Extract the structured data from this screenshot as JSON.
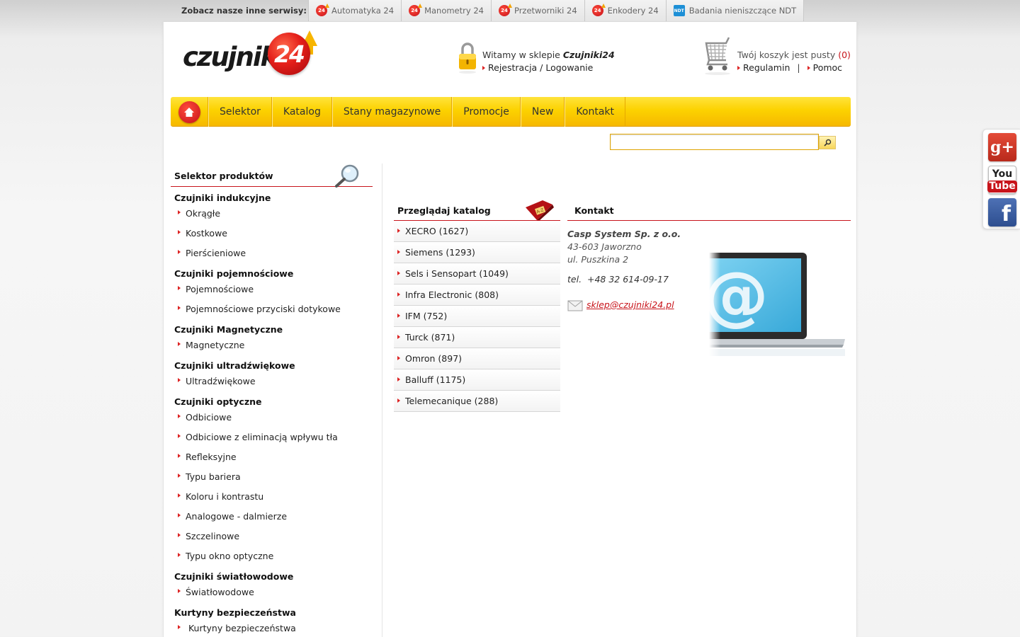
{
  "topbar": {
    "label": "Zobacz nasze inne serwisy:",
    "services": [
      {
        "label": "Automatyka 24",
        "icon": "24-logo-icon",
        "badge": "24"
      },
      {
        "label": "Manometry 24",
        "icon": "24-logo-icon",
        "badge": "24"
      },
      {
        "label": "Przetworniki 24",
        "icon": "24-logo-icon",
        "badge": "24"
      },
      {
        "label": "Enkodery 24",
        "icon": "24-logo-icon",
        "badge": "24"
      },
      {
        "label": "Badania nieniszczące NDT",
        "icon": "ndt-logo-icon",
        "badge": "NDT"
      }
    ]
  },
  "logo": {
    "word": "czujniki",
    "number": "24"
  },
  "welcome": {
    "text": "Witamy w sklepie ",
    "shop": "Czujniki24",
    "auth_link": "Rejestracja / Logowanie"
  },
  "cart": {
    "status": "Twój koszyk jest pusty",
    "count": "(0)",
    "terms": "Regulamin",
    "separator": "|",
    "help": "Pomoc"
  },
  "nav": {
    "home_icon": "home-icon",
    "items": [
      "Selektor",
      "Katalog",
      "Stany magazynowe",
      "Promocje",
      "New",
      "Kontakt"
    ]
  },
  "search": {
    "placeholder": "",
    "value": ""
  },
  "sidebar": {
    "title": "Selektor produktów",
    "groups": [
      {
        "title": "Czujniki indukcyjne",
        "items": [
          "Okrągłe",
          "Kostkowe",
          "Pierścieniowe"
        ]
      },
      {
        "title": "Czujniki pojemnościowe",
        "items": [
          "Pojemnościowe",
          "Pojemnościowe przyciski dotykowe"
        ]
      },
      {
        "title": "Czujniki Magnetyczne",
        "items": [
          "Magnetyczne"
        ]
      },
      {
        "title": "Czujniki ultradźwiękowe",
        "items": [
          "Ultradźwiękowe"
        ]
      },
      {
        "title": "Czujniki optyczne",
        "items": [
          "Odbiciowe",
          "Odbiciowe z eliminacją wpływu tła",
          "Refleksyjne",
          "Typu bariera",
          "Koloru i kontrastu",
          "Analogowe - dalmierze",
          "Szczelinowe",
          "Typu okno optyczne"
        ]
      },
      {
        "title": "Czujniki światłowodowe",
        "items": [
          "Światłowodowe"
        ]
      },
      {
        "title": "Kurtyny bezpieczeństwa",
        "items": [
          " Kurtyny bezpieczeństwa"
        ]
      }
    ]
  },
  "catalog": {
    "title": "Przeglądaj katalog",
    "items": [
      "XECRO (1627)",
      "Siemens (1293)",
      "Sels i Sensopart (1049)",
      "Infra Electronic (808)",
      "IFM (752)",
      "Turck (871)",
      "Omron (897)",
      "Balluff (1175)",
      "Telemecanique (288)"
    ]
  },
  "contact": {
    "title": "Kontakt",
    "company": "Casp System Sp. z o.o.",
    "address_line1": "43-603 Jaworzno",
    "address_line2": "ul. Puszkina 2",
    "phone": "tel.  +48 32 614-09-17",
    "email": "sklep@czujniki24.pl"
  },
  "social": {
    "gplus": "g+",
    "youtube_you": "You",
    "youtube_tube": "Tube",
    "facebook": "f"
  },
  "colors": {
    "accent_red": "#c8141b",
    "nav_yellow": "#fcd200",
    "nav_border": "#e6a800"
  }
}
